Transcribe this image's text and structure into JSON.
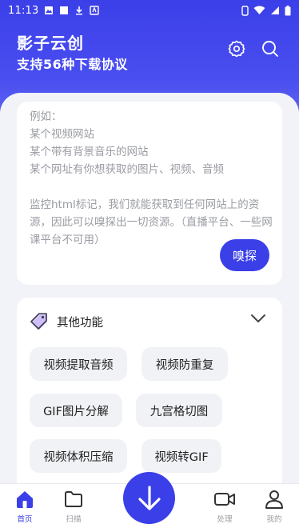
{
  "status_bar": {
    "time": "11:13"
  },
  "header": {
    "title": "影子云创",
    "subtitle": "支持56种下载协议"
  },
  "input_card": {
    "placeholder": "例如：\n某个视频网站\n某个带有背景音乐的网站\n某个网址有你想获取的图片、视频、音频\n\n监控html标记，我们就能获取到任何网站上的资源，因此可以嗅探出一切资源。（直播平台、一些网课平台不可用）",
    "sniff_button": "嗅探"
  },
  "functions": {
    "title": "其他功能",
    "items": [
      {
        "label": "视频提取音频"
      },
      {
        "label": "视频防重复"
      },
      {
        "label": "GIF图片分解"
      },
      {
        "label": "九宫格切图"
      },
      {
        "label": "视频体积压缩"
      },
      {
        "label": "视频转GIF"
      }
    ]
  },
  "bottom_nav": {
    "items": [
      {
        "label": "首页",
        "icon": "home-icon",
        "active": true
      },
      {
        "label": "扫描",
        "icon": "folder-icon",
        "active": false
      },
      {
        "label": "处理",
        "icon": "video-camera-icon",
        "active": false
      },
      {
        "label": "我的",
        "icon": "user-icon",
        "active": false
      }
    ],
    "fab_icon": "download-arrow-icon"
  },
  "colors": {
    "primary": "#3b3fe8",
    "background": "#f2f3f8",
    "hint_text": "#9a9ca3"
  }
}
